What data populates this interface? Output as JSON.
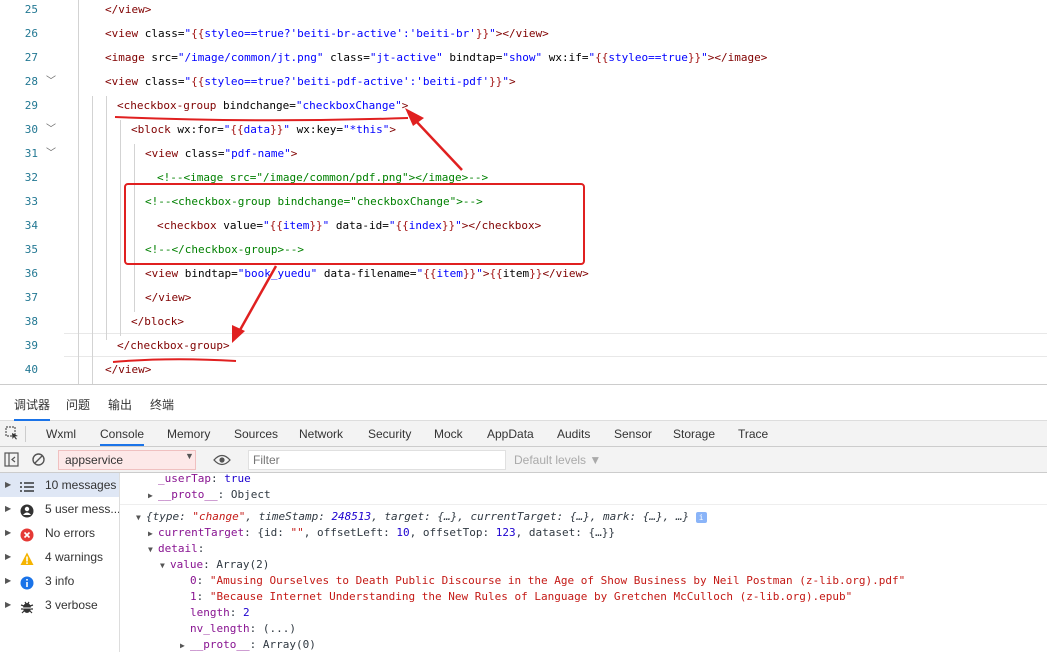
{
  "editor": {
    "lines": [
      {
        "num": "25",
        "parts": [
          [
            "tag",
            "</view>"
          ]
        ]
      },
      {
        "num": "26",
        "parts": [
          [
            "tag",
            "<view "
          ],
          [
            "txt",
            "class="
          ],
          [
            "str",
            "\""
          ],
          [
            "brace",
            "{{"
          ],
          [
            "str",
            "styleo==true?'beiti-br-active':'beiti-br'"
          ],
          [
            "brace",
            "}}"
          ],
          [
            "str",
            "\""
          ],
          [
            "tag",
            "></view>"
          ]
        ]
      },
      {
        "num": "27",
        "parts": [
          [
            "tag",
            "<image "
          ],
          [
            "txt",
            "src="
          ],
          [
            "str",
            "\"/image/common/jt.png\""
          ],
          [
            "txt",
            " class="
          ],
          [
            "str",
            "\"jt-active\""
          ],
          [
            "txt",
            " bindtap="
          ],
          [
            "str",
            "\"show\""
          ],
          [
            "txt",
            " wx:if="
          ],
          [
            "str",
            "\""
          ],
          [
            "brace",
            "{{"
          ],
          [
            "str",
            "styleo==true"
          ],
          [
            "brace",
            "}}"
          ],
          [
            "str",
            "\""
          ],
          [
            "tag",
            "></image>"
          ]
        ]
      },
      {
        "num": "28",
        "parts": [
          [
            "tag",
            "<view "
          ],
          [
            "txt",
            "class="
          ],
          [
            "str",
            "\""
          ],
          [
            "brace",
            "{{"
          ],
          [
            "str",
            "styleo==true?'beiti-pdf-active':'beiti-pdf'"
          ],
          [
            "brace",
            "}}"
          ],
          [
            "str",
            "\""
          ],
          [
            "tag",
            ">"
          ]
        ]
      },
      {
        "num": "29",
        "parts": [
          [
            "tag",
            "<checkbox-group "
          ],
          [
            "txt",
            "bindchange="
          ],
          [
            "str",
            "\"checkboxChange\""
          ],
          [
            "tag",
            ">"
          ]
        ]
      },
      {
        "num": "30",
        "parts": [
          [
            "tag",
            "<block "
          ],
          [
            "txt",
            "wx:for="
          ],
          [
            "str",
            "\""
          ],
          [
            "brace",
            "{{"
          ],
          [
            "str",
            "data"
          ],
          [
            "brace",
            "}}"
          ],
          [
            "str",
            "\""
          ],
          [
            "txt",
            " wx:key="
          ],
          [
            "str",
            "\"*this\""
          ],
          [
            "tag",
            ">"
          ]
        ]
      },
      {
        "num": "31",
        "parts": [
          [
            "tag",
            "<view "
          ],
          [
            "txt",
            "class="
          ],
          [
            "str",
            "\"pdf-name\""
          ],
          [
            "tag",
            ">"
          ]
        ]
      },
      {
        "num": "32",
        "parts": [
          [
            "cmt",
            "<!--<image src=\"/image/common/pdf.png\"></image>-->"
          ]
        ]
      },
      {
        "num": "33",
        "parts": [
          [
            "cmt",
            "<!--<checkbox-group bindchange=\"checkboxChange\">-->"
          ]
        ]
      },
      {
        "num": "34",
        "parts": [
          [
            "tag",
            "<checkbox "
          ],
          [
            "txt",
            "value="
          ],
          [
            "str",
            "\""
          ],
          [
            "brace",
            "{{"
          ],
          [
            "str",
            "item"
          ],
          [
            "brace",
            "}}"
          ],
          [
            "str",
            "\""
          ],
          [
            "txt",
            " data-id="
          ],
          [
            "str",
            "\""
          ],
          [
            "brace",
            "{{"
          ],
          [
            "str",
            "index"
          ],
          [
            "brace",
            "}}"
          ],
          [
            "str",
            "\""
          ],
          [
            "tag",
            "></checkbox>"
          ]
        ]
      },
      {
        "num": "35",
        "parts": [
          [
            "cmt",
            "<!--</checkbox-group>-->"
          ]
        ]
      },
      {
        "num": "36",
        "parts": [
          [
            "tag",
            "<view "
          ],
          [
            "txt",
            "bindtap="
          ],
          [
            "str",
            "\"book_yuedu\""
          ],
          [
            "txt",
            " data-filename="
          ],
          [
            "str",
            "\""
          ],
          [
            "brace",
            "{{"
          ],
          [
            "str",
            "item"
          ],
          [
            "brace",
            "}}"
          ],
          [
            "str",
            "\""
          ],
          [
            "tag",
            ">"
          ],
          [
            "brace",
            "{{"
          ],
          [
            "txt",
            "item"
          ],
          [
            "brace",
            "}}"
          ],
          [
            "tag",
            "</view>"
          ]
        ]
      },
      {
        "num": "37",
        "parts": [
          [
            "tag",
            "</view>"
          ]
        ]
      },
      {
        "num": "38",
        "parts": [
          [
            "tag",
            "</block>"
          ]
        ]
      },
      {
        "num": "39",
        "parts": [
          [
            "tag",
            "</checkbox-group>"
          ]
        ]
      },
      {
        "num": "40",
        "parts": [
          [
            "tag",
            "</view>"
          ]
        ]
      }
    ]
  },
  "devtools": {
    "top_tabs": [
      "调试器",
      "问题",
      "输出",
      "终端"
    ],
    "panel_tabs": [
      "Wxml",
      "Console",
      "Memory",
      "Sources",
      "Network",
      "Security",
      "Mock",
      "AppData",
      "Audits",
      "Sensor",
      "Storage",
      "Trace"
    ],
    "selected_panel": "Console",
    "context": "appservice",
    "filter_placeholder": "Filter",
    "levels_label": "Default levels ▼",
    "sidebar": [
      {
        "label": "10 messages",
        "icon": "list-icon",
        "color": "#5f6368"
      },
      {
        "label": "5 user mess...",
        "icon": "user-icon",
        "color": "#333333"
      },
      {
        "label": "No errors",
        "icon": "error-icon",
        "color": "#e53935"
      },
      {
        "label": "4 warnings",
        "icon": "warning-icon",
        "color": "#f5b400"
      },
      {
        "label": "3 info",
        "icon": "info-icon",
        "color": "#1a73e8"
      },
      {
        "label": "3 verbose",
        "icon": "bug-icon",
        "color": "#333333"
      }
    ],
    "console_lines": [
      {
        "indent": 0,
        "tri": "",
        "parts": [
          [
            "k",
            "_userTap"
          ],
          [
            "d",
            ": "
          ],
          [
            "n",
            "true"
          ]
        ]
      },
      {
        "indent": 0,
        "tri": "▶",
        "parts": [
          [
            "k",
            "__proto__"
          ],
          [
            "d",
            ": Object"
          ]
        ]
      },
      {
        "indent": -1,
        "tri": "▼",
        "parts": [
          [
            "d i",
            "{type: "
          ],
          [
            "s i",
            "\"change\""
          ],
          [
            "d i",
            ", timeStamp: "
          ],
          [
            "n i",
            "248513"
          ],
          [
            "d i",
            ", target: {…}, currentTarget: {…}, mark: {…}, …} "
          ]
        ],
        "badge": "i"
      },
      {
        "indent": 0,
        "tri": "▶",
        "parts": [
          [
            "k",
            "currentTarget"
          ],
          [
            "d",
            ": {id: "
          ],
          [
            "s",
            "\"\""
          ],
          [
            "d",
            ", offsetLeft: "
          ],
          [
            "n",
            "10"
          ],
          [
            "d",
            ", offsetTop: "
          ],
          [
            "n",
            "123"
          ],
          [
            "d",
            ", dataset: {…}}"
          ]
        ]
      },
      {
        "indent": 0,
        "tri": "▼",
        "parts": [
          [
            "k",
            "detail"
          ],
          [
            "d",
            ":"
          ]
        ]
      },
      {
        "indent": 1,
        "tri": "▼",
        "parts": [
          [
            "k",
            "value"
          ],
          [
            "d",
            ": Array(2)"
          ]
        ]
      },
      {
        "indent": 2,
        "tri": "",
        "parts": [
          [
            "k",
            "0"
          ],
          [
            "d",
            ": "
          ],
          [
            "s",
            "\"Amusing Ourselves to Death Public Discourse in the Age of Show Business by Neil Postman (z-lib.org).pdf\""
          ]
        ]
      },
      {
        "indent": 2,
        "tri": "",
        "parts": [
          [
            "k",
            "1"
          ],
          [
            "d",
            ": "
          ],
          [
            "s",
            "\"Because Internet Understanding the New Rules of Language by Gretchen McCulloch (z-lib.org).epub\""
          ]
        ]
      },
      {
        "indent": 2,
        "tri": "",
        "parts": [
          [
            "k",
            "length"
          ],
          [
            "d",
            ": "
          ],
          [
            "n",
            "2"
          ]
        ]
      },
      {
        "indent": 2,
        "tri": "",
        "parts": [
          [
            "k",
            "nv_length"
          ],
          [
            "d",
            ": (...)"
          ]
        ]
      },
      {
        "indent": 2,
        "tri": "▶",
        "parts": [
          [
            "k",
            "__proto__"
          ],
          [
            "d",
            ": Array(0)"
          ]
        ]
      }
    ]
  },
  "colors": {
    "annotation": "#e02020",
    "accent": "#1a73e8"
  }
}
